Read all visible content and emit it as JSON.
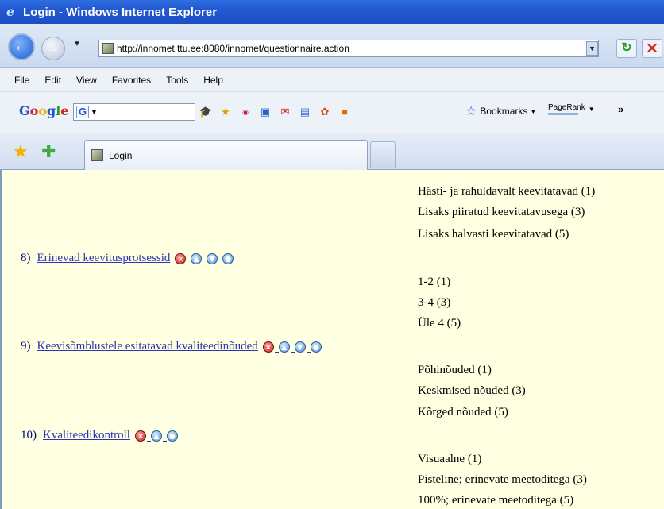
{
  "window": {
    "title": "Login - Windows Internet Explorer"
  },
  "address_bar": {
    "url": "http://innomet.ttu.ee:8080/innomet/questionnaire.action"
  },
  "menu": [
    "File",
    "Edit",
    "View",
    "Favorites",
    "Tools",
    "Help"
  ],
  "google_toolbar": {
    "logo": "Google",
    "search_badge": "G",
    "bookmarks_label": "Bookmarks",
    "pagerank_label": "PageRank"
  },
  "tab": {
    "title": "Login"
  },
  "questions": [
    {
      "number": "8)",
      "title": "Erinevad keevitusprotsessid",
      "preceding_options": [
        "Hästi- ja rahuldavalt keevitatavad (1)",
        "Lisaks piiratud keevitatavusega (3)",
        "Lisaks halvasti keevitatavad (5)"
      ],
      "buttons": [
        "delete-icon",
        "up-icon",
        "down-icon",
        "edit-icon"
      ]
    },
    {
      "number": "9)",
      "title": "Keevisõmblustele esitatavad kvaliteedinõuded",
      "preceding_options": [
        "1-2 (1)",
        "3-4 (3)",
        "Üle 4 (5)"
      ],
      "buttons": [
        "delete-icon",
        "up-icon",
        "down-icon",
        "edit-icon"
      ]
    },
    {
      "number": "10)",
      "title": "Kvaliteedikontroll",
      "preceding_options": [
        "Põhinõuded (1)",
        "Keskmised nõuded (3)",
        "Kõrged nõuded (5)"
      ],
      "buttons": [
        "delete-icon",
        "up-icon",
        "edit-icon"
      ]
    }
  ],
  "trailing_options": [
    "Visuaalne (1)",
    "Pisteline; erinevate meetoditega (3)",
    "100%; erinevate meetoditega (5)"
  ]
}
